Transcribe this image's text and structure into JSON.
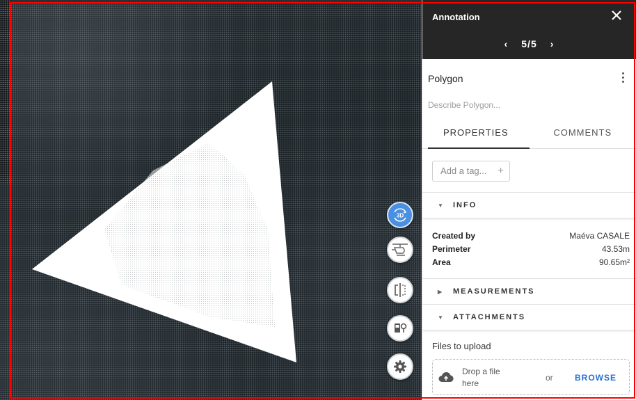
{
  "panel": {
    "title": "Annotation",
    "pager": {
      "prev": "‹",
      "count": "5/5",
      "next": "›"
    },
    "item_title": "Polygon",
    "description_placeholder": "Describe Polygon...",
    "tabs": [
      {
        "label": "PROPERTIES",
        "active": true
      },
      {
        "label": "COMMENTS",
        "active": false
      }
    ],
    "tag_placeholder": "Add a tag...",
    "tag_plus": "+",
    "sections": {
      "info": "INFO",
      "measurements": "MEASUREMENTS",
      "attachments": "ATTACHMENTS"
    },
    "info": [
      {
        "key": "Created by",
        "value": "Maéva CASALE"
      },
      {
        "key": "Perimeter",
        "value": "43.53m"
      },
      {
        "key": "Area",
        "value": "90.65m²"
      }
    ],
    "files_label": "Files to upload",
    "dropzone": {
      "text": "Drop a file here",
      "or": "or",
      "browse": "BROWSE"
    }
  },
  "map_buttons": [
    {
      "name": "3d-view",
      "label": "3D",
      "active": true
    },
    {
      "name": "helicopter-view",
      "active": false
    },
    {
      "name": "split-view",
      "active": false
    },
    {
      "name": "street-view",
      "active": false
    },
    {
      "name": "settings",
      "active": false
    }
  ],
  "colors": {
    "accent": "#4a90e2",
    "selection_border": "#ff0000",
    "header_bg": "#262626",
    "browse_link": "#2a6fd1"
  }
}
